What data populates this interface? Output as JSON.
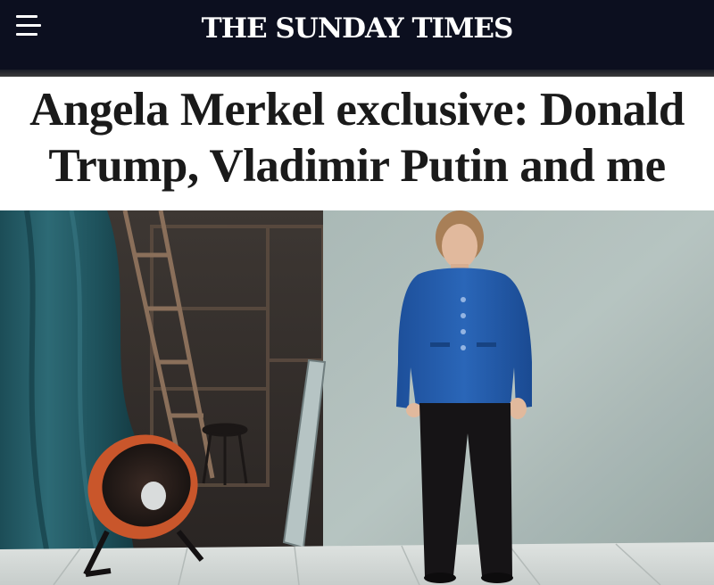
{
  "masthead": {
    "brand": "THE SUNDAY TIMES",
    "menu_icon": "hamburger-menu-icon",
    "background": "#0c0f1f"
  },
  "article": {
    "headline_line1": "Angela Merkel exclusive: Donald",
    "headline_line2": "Trump, Vladimir Putin and me"
  },
  "hero_image": {
    "subject": "portrait-photo",
    "icon": "photo-icon"
  }
}
